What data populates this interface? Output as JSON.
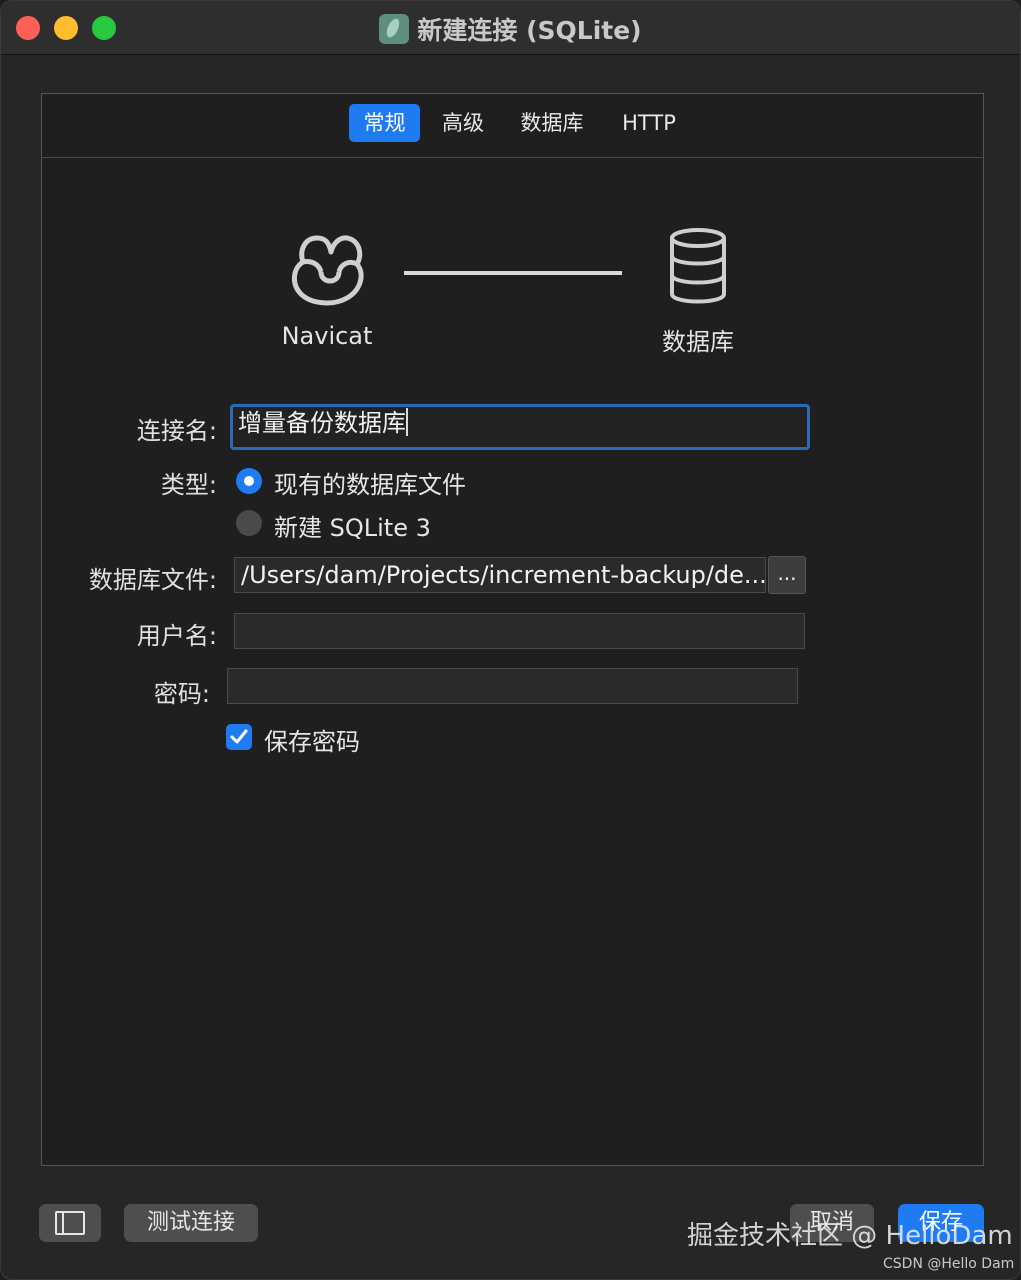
{
  "window": {
    "title": "新建连接 (SQLite)",
    "icon": "navicat-feather-icon"
  },
  "tabs": [
    {
      "label": "常规",
      "active": true
    },
    {
      "label": "高级",
      "active": false
    },
    {
      "label": "数据库",
      "active": false
    },
    {
      "label": "HTTP",
      "active": false
    }
  ],
  "diagram": {
    "left_caption": "Navicat",
    "right_caption": "数据库",
    "left_icon": "navicat-logo-icon",
    "right_icon": "database-icon"
  },
  "form": {
    "connection_name_label": "连接名:",
    "connection_name_value": "增量备份数据库",
    "type_label": "类型:",
    "type_options": [
      {
        "label": "现有的数据库文件",
        "selected": true
      },
      {
        "label": "新建 SQLite 3",
        "selected": false
      }
    ],
    "db_file_label": "数据库文件:",
    "db_file_value": "/Users/dam/Projects/increment-backup/de...",
    "browse_label": "...",
    "username_label": "用户名:",
    "username_value": "",
    "password_label": "密码:",
    "password_value": "",
    "save_password_label": "保存密码",
    "save_password_checked": true
  },
  "footer": {
    "test_connection_label": "测试连接",
    "cancel_label": "取消",
    "save_label": "保存"
  },
  "watermark": {
    "main": "掘金技术社区 @ HelloDam",
    "small": "CSDN @Hello Dam"
  },
  "colors": {
    "accent": "#1f7bf2",
    "focus_ring": "#2b6ab8",
    "background": "#1f1f1f"
  }
}
